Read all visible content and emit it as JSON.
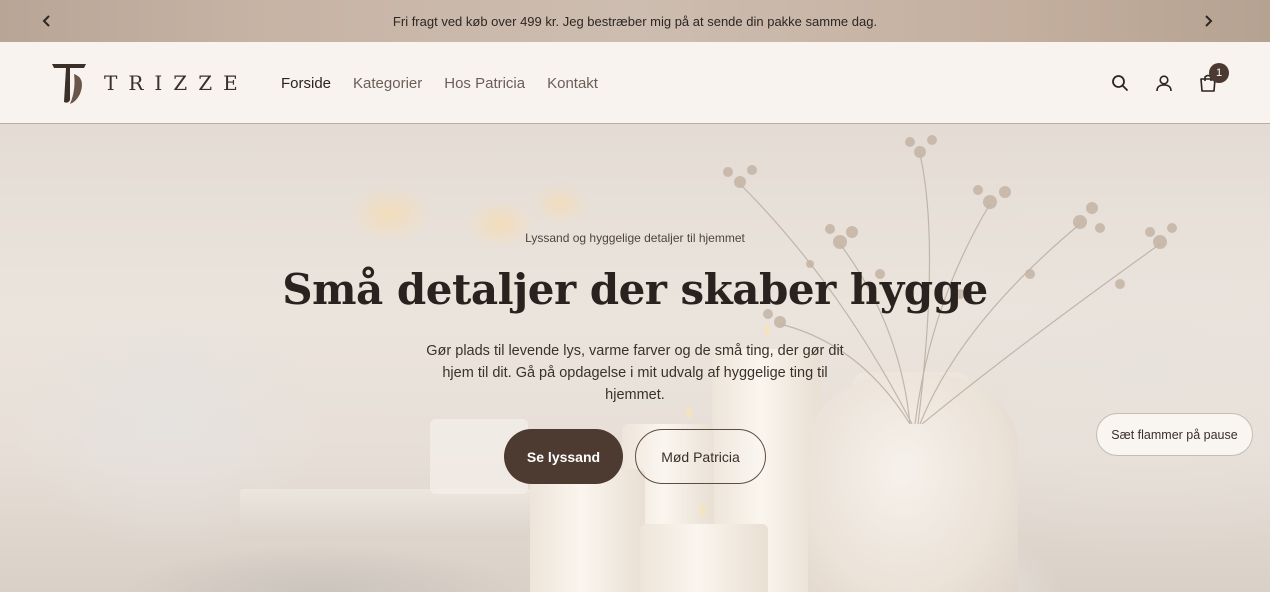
{
  "announcement": {
    "text": "Fri fragt ved køb over 499 kr. Jeg bestræber mig på at sende din pakke samme dag.",
    "prev_icon": "chevron-left-icon",
    "next_icon": "chevron-right-icon"
  },
  "header": {
    "logo_text": "TRIZZE",
    "nav": [
      {
        "label": "Forside",
        "active": true
      },
      {
        "label": "Kategorier"
      },
      {
        "label": "Hos Patricia"
      },
      {
        "label": "Kontakt"
      }
    ],
    "icons": [
      "search-icon",
      "account-icon",
      "cart-icon"
    ],
    "cart_count": "1"
  },
  "hero": {
    "eyebrow": "Lyssand og hyggelige detaljer til hjemmet",
    "headline": "Små detaljer der skaber hygge",
    "subtext": "Gør plads til levende lys, varme farver og de små ting, der gør dit hjem til dit. Gå på opdagelse i mit udvalg af hyggelige ting til hjemmet.",
    "primary_button": "Se lyssand",
    "secondary_button": "Mød Patricia"
  },
  "pause_button": "Sæt flammer på pause",
  "colors": {
    "primary_brown": "#4d3b31",
    "header_bg": "#f8f3ee"
  }
}
